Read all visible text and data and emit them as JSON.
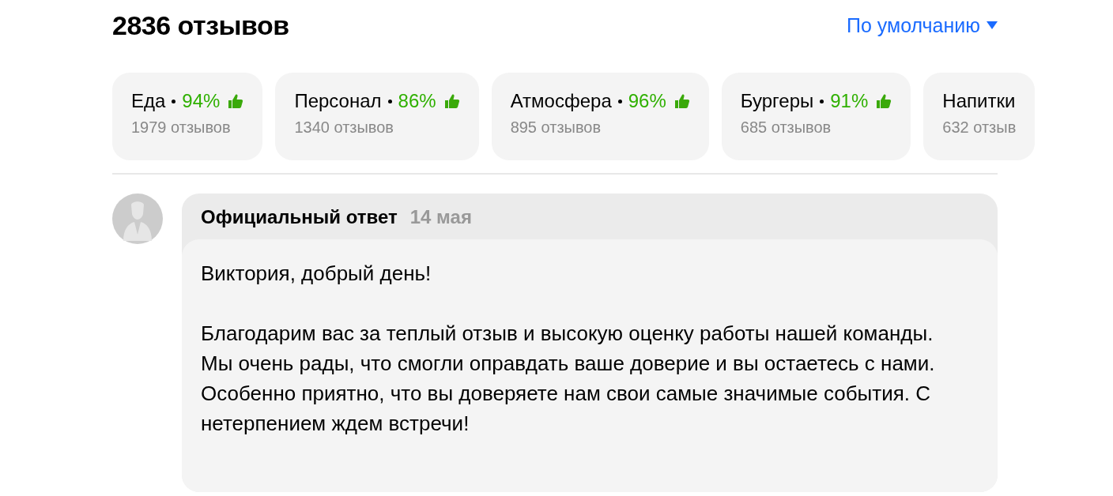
{
  "header": {
    "title": "2836 отзывов",
    "sort": "По умолчанию"
  },
  "categories": [
    {
      "name": "Еда",
      "percent": "94%",
      "count": "1979 отзывов"
    },
    {
      "name": "Персонал",
      "percent": "86%",
      "count": "1340 отзывов"
    },
    {
      "name": "Атмосфера",
      "percent": "96%",
      "count": "895 отзывов"
    },
    {
      "name": "Бургеры",
      "percent": "91%",
      "count": "685 отзывов"
    },
    {
      "name": "Напитки",
      "count": "632 отзыв"
    }
  ],
  "reply": {
    "author": "Официальный ответ",
    "date": "14 мая",
    "paragraphs": [
      "Виктория, добрый день!",
      "Благодарим вас за теплый отзыв и высокую оценку работы нашей команды. Мы очень рады, что смогли оправдать ваше доверие и вы остаетесь с нами. Особенно приятно, что вы доверяете нам свои самые значимые события. С нетерпением ждем встречи!"
    ]
  }
}
